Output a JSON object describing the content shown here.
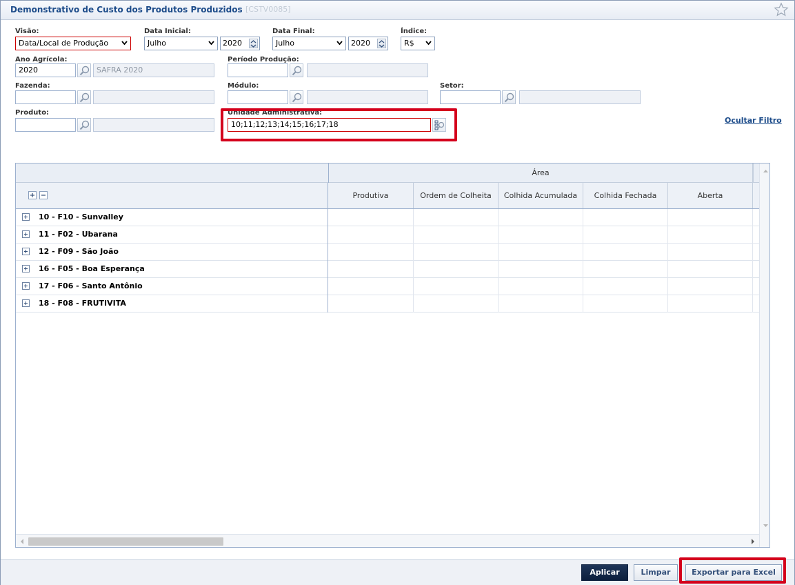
{
  "window": {
    "title": "Demonstrativo de Custo dos Produtos Produzidos",
    "code": "[CSTV0085]"
  },
  "filters": {
    "visao": {
      "label": "Visão:",
      "value": "Data/Local de Produção"
    },
    "data_inicial": {
      "label": "Data Inicial:",
      "month": "Julho",
      "year": "2020"
    },
    "data_final": {
      "label": "Data Final:",
      "month": "Julho",
      "year": "2020"
    },
    "indice": {
      "label": "Índice:",
      "value": "R$"
    },
    "ano_agricola": {
      "label": "Ano Agrícola:",
      "value": "2020",
      "description": "SAFRA 2020"
    },
    "periodo_producao": {
      "label": "Período Produção:",
      "value": "",
      "description": ""
    },
    "fazenda": {
      "label": "Fazenda:",
      "value": "",
      "description": ""
    },
    "modulo": {
      "label": "Módulo:",
      "value": "",
      "description": ""
    },
    "setor": {
      "label": "Setor:",
      "value": "",
      "description": ""
    },
    "produto": {
      "label": "Produto:",
      "value": "",
      "description": ""
    },
    "unidade_administrativa": {
      "label": "Unidade Administrativa:",
      "value": "10;11;12;13;14;15;16;17;18"
    },
    "hide_filter_label": "Ocultar Filtro"
  },
  "grid": {
    "group_header": "Área",
    "columns": [
      "Produtiva",
      "Ordem de Colheita",
      "Colhida Acumulada",
      "Colhida Fechada",
      "Aberta"
    ],
    "rows": [
      "10 - F10 - Sunvalley",
      "11 - F02 - Ubarana",
      "12 - F09 - São João",
      "16 - F05 - Boa Esperança",
      "17 - F06 - Santo Antônio",
      "18 - F08 - FRUTIVITA"
    ]
  },
  "footer": {
    "apply_label": "Aplicar",
    "clear_label": "Limpar",
    "export_label": "Exportar para Excel"
  },
  "colors": {
    "title": "#1d4c8a",
    "highlight": "#d4001c",
    "primary_button": "#0c1f3d"
  }
}
